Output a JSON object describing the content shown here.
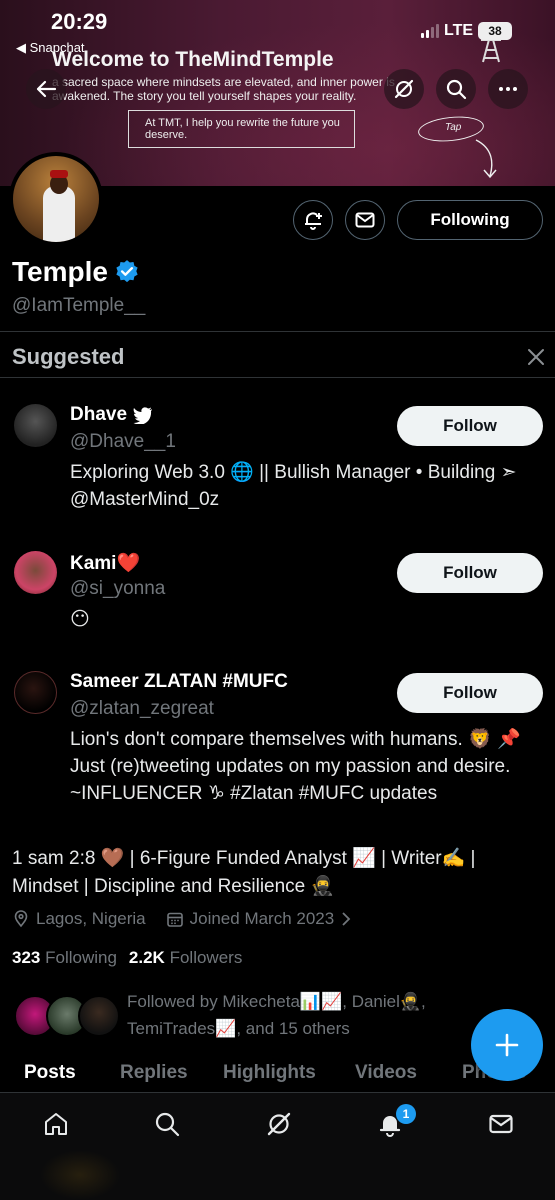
{
  "status_bar": {
    "time": "20:29",
    "back_app": "◀ Snapchat",
    "network": "LTE",
    "battery": "38"
  },
  "banner": {
    "title": "Welcome to TheMindTemple",
    "subtitle": "a sacred space where mindsets are elevated, and inner power is awakened. The story you tell yourself shapes your reality.",
    "box_text": "At TMT, I help you rewrite the future you deserve.",
    "tap_label": "Tap"
  },
  "profile": {
    "following_button": "Following",
    "name": "Temple",
    "handle": "@IamTemple__",
    "bio": "1 sam 2:8 🤎 | 6-Figure Funded Analyst 📈 | Writer✍️ | Mindset | Discipline and Resilience 🥷",
    "location": "Lagos, Nigeria",
    "joined": "Joined March 2023",
    "following_count": "323",
    "following_label": "Following",
    "followers_count": "2.2K",
    "followers_label": "Followers",
    "followed_by": "Followed by Mikecheta📊📈, Daniel🥷, TemiTrades📈, and 15 others"
  },
  "suggested": {
    "title": "Suggested",
    "items": [
      {
        "name": "Dhave",
        "handle": "@Dhave__1",
        "bio": "Exploring Web 3.0 🌐 || Bullish Manager • Building ➣ @MasterMind_0z",
        "button": "Follow"
      },
      {
        "name": "Kami❤️",
        "handle": "@si_yonna",
        "bio": "😶",
        "button": "Follow"
      },
      {
        "name": "Sameer ZLATAN #MUFC",
        "handle": "@zlatan_zegreat",
        "bio": "Lion's don't compare themselves with humans. 🦁 📌 Just (re)tweeting updates on my passion and desire. ~INFLUENCER ♑ #Zlatan #MUFC updates",
        "button": "Follow"
      }
    ]
  },
  "tabs": [
    "Posts",
    "Replies",
    "Highlights",
    "Videos",
    "Photos"
  ],
  "nav": {
    "notifications_badge": "1"
  },
  "colors": {
    "accent": "#1d9bf0",
    "background": "#000000",
    "muted": "#71767b"
  }
}
